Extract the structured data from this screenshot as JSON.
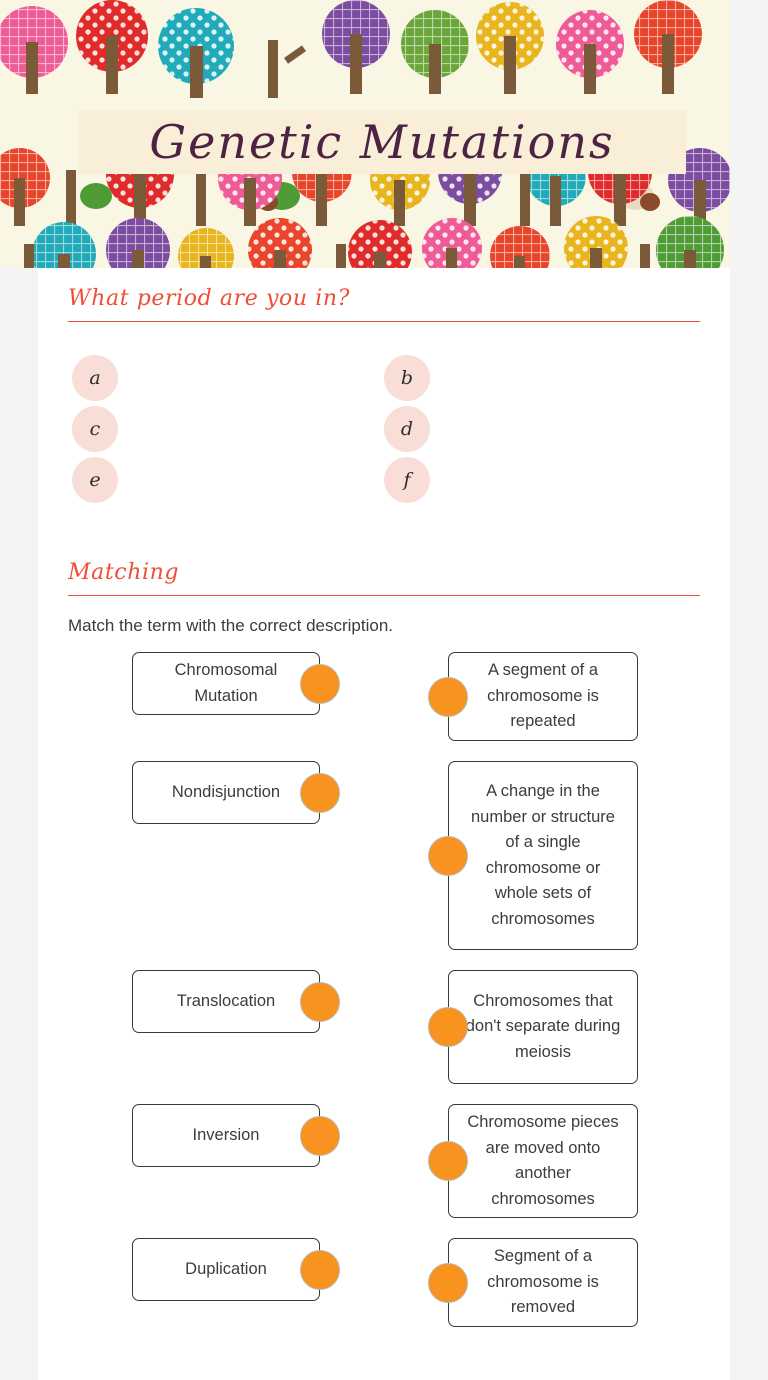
{
  "header": {
    "title": "Genetic Mutations",
    "banner_bg_color": "#faf6e4",
    "plate_bg_color": "#f9eed8",
    "title_color": "#4d2343"
  },
  "theme": {
    "accent_color": "#f04e37",
    "dot_color": "#f7931e",
    "option_circle_color": "#f8ded6",
    "page_bg_color": "#f4f4f7",
    "card_bg_color": "#ffffff"
  },
  "sections": {
    "multiple_choice": {
      "heading": "What period are you in?",
      "options": [
        {
          "letter": "a"
        },
        {
          "letter": "b"
        },
        {
          "letter": "c"
        },
        {
          "letter": "d"
        },
        {
          "letter": "e"
        },
        {
          "letter": "f"
        }
      ]
    },
    "matching": {
      "heading": "Matching",
      "instruction": "Match the term with the correct description.",
      "pairs": [
        {
          "term": "Chromosomal Mutation",
          "description": "A segment of a chromosome is repeated"
        },
        {
          "term": "Nondisjunction",
          "description": "A change in the number or structure of a single chromosome or whole sets of chromosomes"
        },
        {
          "term": "Translocation",
          "description": "Chromosomes that don't separate during meiosis"
        },
        {
          "term": "Inversion",
          "description": "Chromosome pieces are moved onto another chromosomes"
        },
        {
          "term": "Duplication",
          "description": "Segment of a chromosome is removed"
        }
      ]
    }
  }
}
